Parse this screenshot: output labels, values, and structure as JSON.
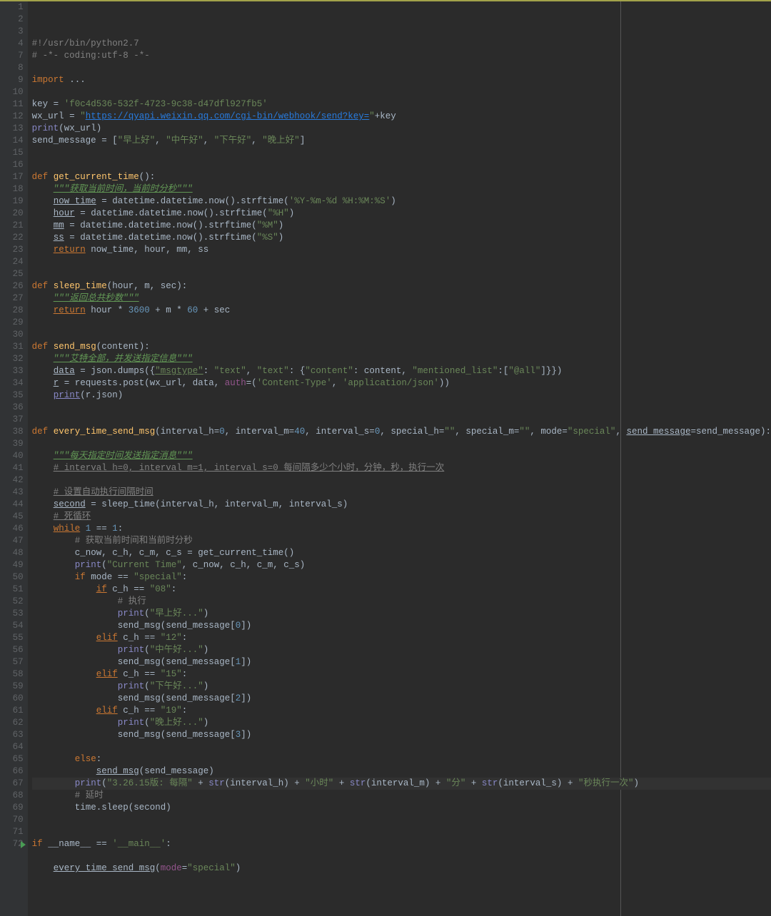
{
  "editor": {
    "line_numbers": [
      "1",
      "2",
      "3",
      "4",
      "7",
      "8",
      "9",
      "10",
      "11",
      "12",
      "13",
      "14",
      "15",
      "16",
      "17",
      "18",
      "19",
      "20",
      "21",
      "22",
      "23",
      "24",
      "25",
      "26",
      "27",
      "28",
      "29",
      "30",
      "31",
      "32",
      "33",
      "34",
      "35",
      "36",
      "37",
      "38",
      "39",
      "40",
      "41",
      "42",
      "43",
      "44",
      "45",
      "46",
      "47",
      "48",
      "49",
      "50",
      "51",
      "52",
      "53",
      "54",
      "55",
      "56",
      "57",
      "58",
      "59",
      "60",
      "61",
      "62",
      "63",
      "64",
      "65",
      "66",
      "67",
      "68",
      "69",
      "70",
      "71",
      "72"
    ],
    "cursor_line": 64,
    "breakpoint_line": 69,
    "lines": {
      "l1": {
        "t": "#!/usr/bin/python2.7",
        "cls": "c-cmt"
      },
      "l2": {
        "t": "# -*- coding:utf-8 -*-",
        "cls": "c-cmt"
      },
      "l4a": {
        "pre": "import ",
        "precls": "c-kw",
        "t": "...",
        "cls": "c-id"
      },
      "l8": {
        "pre": "key = ",
        "t": "'f0c4d536-532f-4723-9c38-d47dfl927fb5'",
        "cls": "c-str"
      },
      "l9a": {
        "t": "wx_url = "
      },
      "l9b": {
        "t": "\"",
        "cls": "c-str"
      },
      "l9c": {
        "t": "https://qyapi.weixin.qq.com/cgi-bin/webhook/send?key=",
        "cls": "c-url"
      },
      "l9d": {
        "t": "\"",
        "cls": "c-str"
      },
      "l9e": {
        "t": "+key"
      },
      "l10": {
        "pre": "print",
        "precls": "c-built",
        "t": "(wx_url)"
      },
      "l11a": {
        "t": "send_message = ["
      },
      "l11b": {
        "t": "\"早上好\"",
        "cls": "c-str"
      },
      "l11c": {
        "t": ", "
      },
      "l11d": {
        "t": "\"中午好\"",
        "cls": "c-str"
      },
      "l11e": {
        "t": ", "
      },
      "l11f": {
        "t": "\"下午好\"",
        "cls": "c-str"
      },
      "l11g": {
        "t": ", "
      },
      "l11h": {
        "t": "\"晚上好\"",
        "cls": "c-str"
      },
      "l11i": {
        "t": "]"
      },
      "l14a": {
        "t": "def ",
        "cls": "c-kw"
      },
      "l14b": {
        "t": "get_current_time",
        "cls": "c-def"
      },
      "l14c": {
        "t": "():"
      },
      "l15": {
        "t": "\"\"\"获取当前时间，当前时分秒\"\"\"",
        "cls": "c-doc c-ul"
      },
      "l16a": {
        "t": "now_time",
        "cls": "c-id c-ul"
      },
      "l16b": {
        "t": " = datetime.datetime.now().strftime("
      },
      "l16c": {
        "t": "'%Y-%m-%d %H:%M:%S'",
        "cls": "c-str"
      },
      "l16d": {
        "t": ")"
      },
      "l17a": {
        "t": "hour",
        "cls": "c-id c-ul"
      },
      "l17b": {
        "t": " = datetime.datetime.now().strftime("
      },
      "l17c": {
        "t": "\"%H\"",
        "cls": "c-str"
      },
      "l17d": {
        "t": ")"
      },
      "l18a": {
        "t": "mm",
        "cls": "c-id c-ul"
      },
      "l18b": {
        "t": " = datetime.datetime.now().strftime("
      },
      "l18c": {
        "t": "\"%M\"",
        "cls": "c-str"
      },
      "l18d": {
        "t": ")"
      },
      "l19a": {
        "t": "ss",
        "cls": "c-id c-ul"
      },
      "l19b": {
        "t": " = datetime.datetime.now().strftime("
      },
      "l19c": {
        "t": "\"%S\"",
        "cls": "c-str"
      },
      "l19d": {
        "t": ")"
      },
      "l20a": {
        "t": "return",
        "cls": "c-kw c-ul"
      },
      "l20b": {
        "t": " now_time, hour, mm, ss"
      },
      "l23a": {
        "t": "def ",
        "cls": "c-kw"
      },
      "l23b": {
        "t": "sleep_time",
        "cls": "c-def"
      },
      "l23c": {
        "t": "(hour, m, sec):"
      },
      "l24": {
        "t": "\"\"\"返回总共秒数\"\"\"",
        "cls": "c-doc c-ul"
      },
      "l25a": {
        "t": "return",
        "cls": "c-kw c-ul"
      },
      "l25b": {
        "t": " hour * "
      },
      "l25c": {
        "t": "3600",
        "cls": "c-num"
      },
      "l25d": {
        "t": " + m * "
      },
      "l25e": {
        "t": "60",
        "cls": "c-num"
      },
      "l25f": {
        "t": " + sec"
      },
      "l28a": {
        "t": "def ",
        "cls": "c-kw"
      },
      "l28b": {
        "t": "send_msg",
        "cls": "c-def"
      },
      "l28c": {
        "t": "(content):"
      },
      "l29": {
        "t": "\"\"\"艾特全部，并发送指定信息\"\"\"",
        "cls": "c-doc c-ul"
      },
      "l30a": {
        "t": "data",
        "cls": "c-id c-ul"
      },
      "l30b": {
        "t": " = json.dumps({"
      },
      "l30c": {
        "t": "\"msgtype\"",
        "cls": "c-str c-ul"
      },
      "l30d": {
        "t": ": "
      },
      "l30e": {
        "t": "\"text\"",
        "cls": "c-str"
      },
      "l30f": {
        "t": ", "
      },
      "l30g": {
        "t": "\"text\"",
        "cls": "c-str"
      },
      "l30h": {
        "t": ": {"
      },
      "l30i": {
        "t": "\"content\"",
        "cls": "c-str"
      },
      "l30j": {
        "t": ": content, "
      },
      "l30k": {
        "t": "\"mentioned_list\"",
        "cls": "c-str"
      },
      "l30l": {
        "t": ":["
      },
      "l30m": {
        "t": "\"@all\"",
        "cls": "c-str"
      },
      "l30n": {
        "t": "]}})"
      },
      "l31a": {
        "t": "r",
        "cls": "c-id c-ul"
      },
      "l31b": {
        "t": " = requests.post(wx_url, data, "
      },
      "l31c": {
        "t": "auth",
        "cls": "c-self"
      },
      "l31d": {
        "t": "=("
      },
      "l31e": {
        "t": "'Content-Type'",
        "cls": "c-str"
      },
      "l31f": {
        "t": ", "
      },
      "l31g": {
        "t": "'application/json'",
        "cls": "c-str"
      },
      "l31h": {
        "t": "))"
      },
      "l32a": {
        "t": "print",
        "cls": "c-built c-ul"
      },
      "l32b": {
        "t": "(r.json)"
      },
      "l35a": {
        "t": "def ",
        "cls": "c-kw"
      },
      "l35b": {
        "t": "every_time_send_msg",
        "cls": "c-def"
      },
      "l35c": {
        "t": "(interval_h="
      },
      "l35d": {
        "t": "0",
        "cls": "c-num"
      },
      "l35e": {
        "t": ", interval_m="
      },
      "l35f": {
        "t": "40",
        "cls": "c-num"
      },
      "l35g": {
        "t": ", interval_s="
      },
      "l35h": {
        "t": "0",
        "cls": "c-num"
      },
      "l35i": {
        "t": ", special_h="
      },
      "l35j": {
        "t": "\"\"",
        "cls": "c-str"
      },
      "l35k": {
        "t": ", special_m="
      },
      "l35l": {
        "t": "\"\"",
        "cls": "c-str"
      },
      "l35m": {
        "t": ", mode="
      },
      "l35n": {
        "t": "\"special\"",
        "cls": "c-str"
      },
      "l35o": {
        "t": ", "
      },
      "l35p": {
        "t": "send_message",
        "cls": "c-id c-ul"
      },
      "l35q": {
        "t": "=send_message):"
      },
      "l37": {
        "t": "\"\"\"每天指定时间发送指定消息\"\"\"",
        "cls": "c-doc c-ul"
      },
      "l38": {
        "t": "# interval_h=0, interval_m=1, interval_s=0 每间隔多少个小时，分钟，秒，执行一次",
        "cls": "c-cmt c-ul"
      },
      "l40": {
        "t": "# 设置自动执行间隔时间",
        "cls": "c-cmt c-ul"
      },
      "l41a": {
        "t": "second",
        "cls": "c-id c-ul"
      },
      "l41b": {
        "t": " = sleep_time(interval_h, interval_m, interval_s)"
      },
      "l42": {
        "t": "# 死循环",
        "cls": "c-cmt c-ul"
      },
      "l43a": {
        "t": "while",
        "cls": "c-kw c-ul"
      },
      "l43b": {
        "t": " "
      },
      "l43c": {
        "t": "1",
        "cls": "c-num"
      },
      "l43d": {
        "t": " == "
      },
      "l43e": {
        "t": "1",
        "cls": "c-num"
      },
      "l43f": {
        "t": ":"
      },
      "l44": {
        "t": "# 获取当前时间和当前时分秒",
        "cls": "c-cmt"
      },
      "l45": {
        "t": "c_now, c_h, c_m, c_s = get_current_time()"
      },
      "l46a": {
        "t": "print",
        "cls": "c-built"
      },
      "l46b": {
        "t": "("
      },
      "l46c": {
        "t": "\"Current Time\"",
        "cls": "c-str"
      },
      "l46d": {
        "t": ", c_now, c_h, c_m, c_s)"
      },
      "l47a": {
        "t": "if",
        "cls": "c-kw"
      },
      "l47b": {
        "t": " mode == "
      },
      "l47c": {
        "t": "\"special\"",
        "cls": "c-str"
      },
      "l47d": {
        "t": ":"
      },
      "l48a": {
        "t": "if",
        "cls": "c-kw c-ul"
      },
      "l48b": {
        "t": " c_h == "
      },
      "l48c": {
        "t": "\"08\"",
        "cls": "c-str"
      },
      "l48d": {
        "t": ":"
      },
      "l49": {
        "t": "# 执行",
        "cls": "c-cmt"
      },
      "l50a": {
        "t": "print",
        "cls": "c-built"
      },
      "l50b": {
        "t": "("
      },
      "l50c": {
        "t": "\"早上好...\"",
        "cls": "c-str"
      },
      "l50d": {
        "t": ")"
      },
      "l51a": {
        "t": "send_msg(send_message["
      },
      "l51b": {
        "t": "0",
        "cls": "c-num"
      },
      "l51c": {
        "t": "])"
      },
      "l52a": {
        "t": "elif",
        "cls": "c-kw c-ul"
      },
      "l52b": {
        "t": " c_h == "
      },
      "l52c": {
        "t": "\"12\"",
        "cls": "c-str"
      },
      "l52d": {
        "t": ":"
      },
      "l53a": {
        "t": "print",
        "cls": "c-built"
      },
      "l53b": {
        "t": "("
      },
      "l53c": {
        "t": "\"中午好...\"",
        "cls": "c-str"
      },
      "l53d": {
        "t": ")"
      },
      "l54a": {
        "t": "send_msg(send_message["
      },
      "l54b": {
        "t": "1",
        "cls": "c-num"
      },
      "l54c": {
        "t": "])"
      },
      "l55a": {
        "t": "elif",
        "cls": "c-kw c-ul"
      },
      "l55b": {
        "t": " c_h == "
      },
      "l55c": {
        "t": "\"15\"",
        "cls": "c-str"
      },
      "l55d": {
        "t": ":"
      },
      "l56a": {
        "t": "print",
        "cls": "c-built"
      },
      "l56b": {
        "t": "("
      },
      "l56c": {
        "t": "\"下午好...\"",
        "cls": "c-str"
      },
      "l56d": {
        "t": ")"
      },
      "l57a": {
        "t": "send_msg(send_message["
      },
      "l57b": {
        "t": "2",
        "cls": "c-num"
      },
      "l57c": {
        "t": "])"
      },
      "l58a": {
        "t": "elif",
        "cls": "c-kw c-ul"
      },
      "l58b": {
        "t": " c_h == "
      },
      "l58c": {
        "t": "\"19\"",
        "cls": "c-str"
      },
      "l58d": {
        "t": ":"
      },
      "l59a": {
        "t": "print",
        "cls": "c-built"
      },
      "l59b": {
        "t": "("
      },
      "l59c": {
        "t": "\"晚上好...\"",
        "cls": "c-str"
      },
      "l59d": {
        "t": ")"
      },
      "l60a": {
        "t": "send_msg(send_message["
      },
      "l60b": {
        "t": "3",
        "cls": "c-num"
      },
      "l60c": {
        "t": "])"
      },
      "l62a": {
        "t": "else",
        "cls": "c-kw"
      },
      "l62b": {
        "t": ":"
      },
      "l63a": {
        "t": "send_msg",
        "cls": "c-id c-ul"
      },
      "l63b": {
        "t": "(send_message)"
      },
      "l64a": {
        "t": "print",
        "cls": "c-built"
      },
      "l64b": {
        "t": "("
      },
      "l64c": {
        "t": "\"3.26.15版: 每隔\"",
        "cls": "c-str"
      },
      "l64d": {
        "t": " + "
      },
      "l64e": {
        "t": "str",
        "cls": "c-built"
      },
      "l64f": {
        "t": "(interval_h) + "
      },
      "l64g": {
        "t": "\"小时\"",
        "cls": "c-str"
      },
      "l64h": {
        "t": " + "
      },
      "l64i": {
        "t": "str",
        "cls": "c-built"
      },
      "l64j": {
        "t": "(interval_m) + "
      },
      "l64k": {
        "t": "\"分\"",
        "cls": "c-str"
      },
      "l64l": {
        "t": " + "
      },
      "l64m": {
        "t": "str",
        "cls": "c-built"
      },
      "l64n": {
        "t": "(interval_s) + "
      },
      "l64o": {
        "t": "\"秒执行一次\"",
        "cls": "c-str"
      },
      "l64p": {
        "t": ")"
      },
      "l65": {
        "t": "# 延时",
        "cls": "c-cmt"
      },
      "l66": {
        "t": "time.sleep(second)"
      },
      "l69a": {
        "t": "if",
        "cls": "c-kw"
      },
      "l69b": {
        "t": " __name__ == "
      },
      "l69c": {
        "t": "'__main__'",
        "cls": "c-str"
      },
      "l69d": {
        "t": ":"
      },
      "l71a": {
        "t": "every_time_send_msg",
        "cls": "c-id c-ul"
      },
      "l71b": {
        "t": "("
      },
      "l71c": {
        "t": "mode",
        "cls": "c-self"
      },
      "l71d": {
        "t": "="
      },
      "l71e": {
        "t": "\"special\"",
        "cls": "c-str"
      },
      "l71f": {
        "t": ")"
      }
    }
  }
}
